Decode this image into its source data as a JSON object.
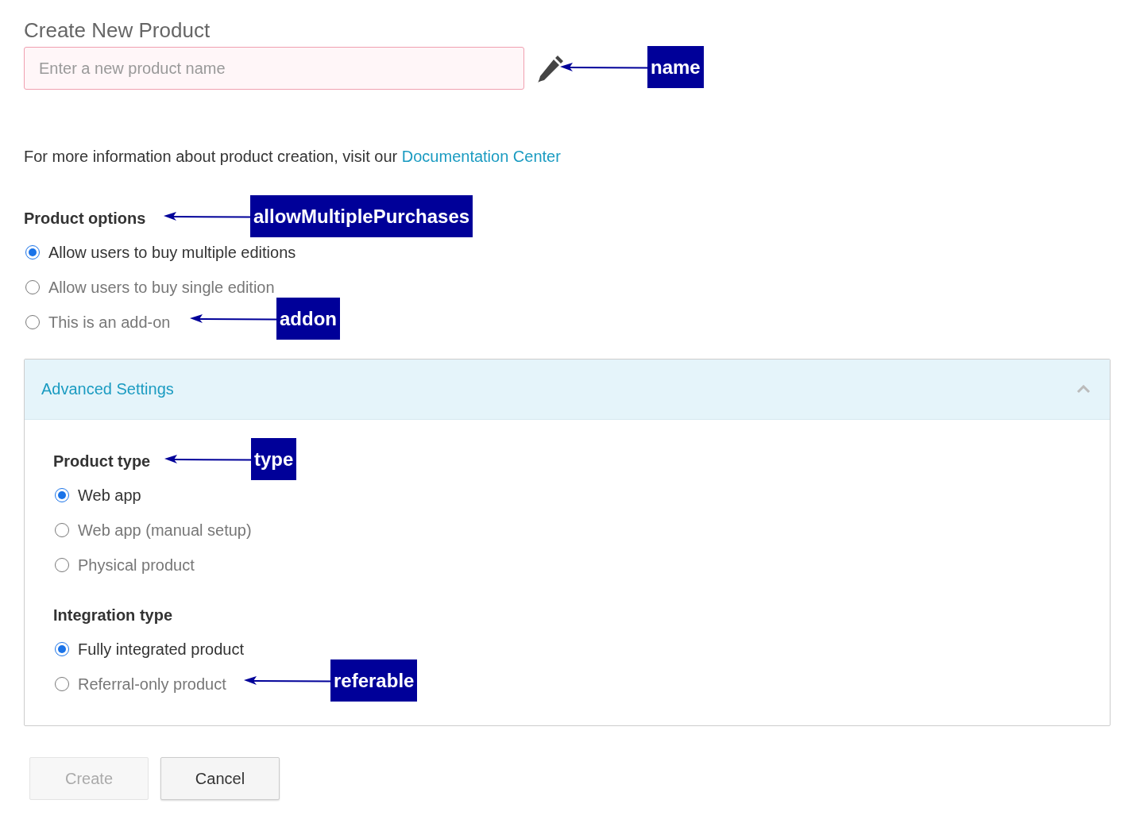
{
  "page": {
    "title": "Create New Product"
  },
  "name_field": {
    "placeholder": "Enter a new product name"
  },
  "info": {
    "text": "For more information about product creation, visit our",
    "link": "Documentation Center"
  },
  "product_options": {
    "label": "Product options",
    "options": [
      {
        "label": "Allow users to buy multiple editions",
        "selected": true
      },
      {
        "label": "Allow users to buy single edition",
        "selected": false
      },
      {
        "label": "This is an add-on",
        "selected": false
      }
    ]
  },
  "advanced_settings": {
    "title": "Advanced Settings",
    "expanded": true,
    "groups": [
      {
        "label": "Product type",
        "options": [
          {
            "label": "Web app",
            "selected": true
          },
          {
            "label": "Web app (manual setup)",
            "selected": false
          },
          {
            "label": "Physical product",
            "selected": false
          }
        ]
      },
      {
        "label": "Integration type",
        "options": [
          {
            "label": "Fully integrated product",
            "selected": true
          },
          {
            "label": "Referral-only product",
            "selected": false
          }
        ]
      }
    ]
  },
  "buttons": [
    {
      "label": "Create",
      "disabled": true
    },
    {
      "label": "Cancel",
      "disabled": false
    }
  ],
  "annotations": [
    {
      "label": "name"
    },
    {
      "label": "allowMultiplePurchases"
    },
    {
      "label": "addon"
    },
    {
      "label": "type"
    },
    {
      "label": "referable"
    }
  ]
}
